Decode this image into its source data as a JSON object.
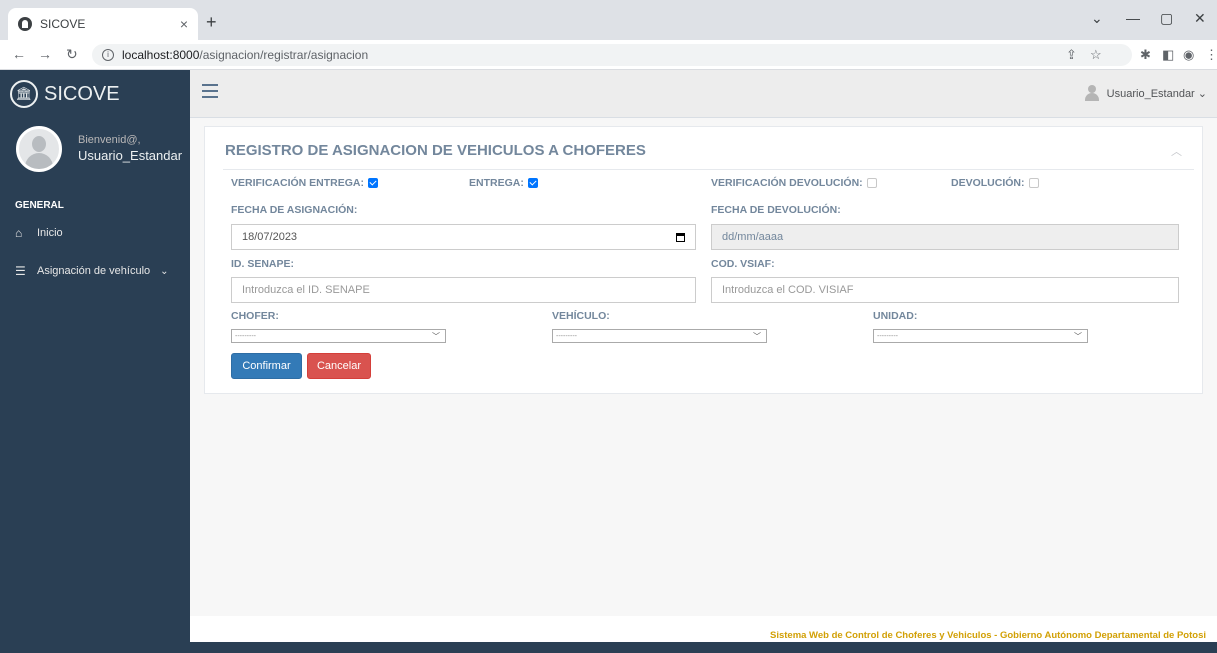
{
  "browser": {
    "tab_title": "SICOVE",
    "tab_close": "×",
    "new_tab": "+",
    "url_host": "localhost:8000",
    "url_path": "/asignacion/registrar/asignacion"
  },
  "sidebar": {
    "brand": "SICOVE",
    "welcome": "Bienvenid@,",
    "username": "Usuario_Estandar",
    "section": "GENERAL",
    "items": [
      {
        "label": "Inicio",
        "icon": "home-icon"
      },
      {
        "label": "Asignación de vehículo",
        "icon": "list-icon"
      }
    ]
  },
  "topnav": {
    "user_label": "Usuario_Estandar ⌄"
  },
  "form": {
    "title": "REGISTRO DE ASIGNACION DE VEHICULOS A CHOFERES",
    "verificacion_entrega": {
      "label": "VERIFICACIÓN ENTREGA:",
      "checked": true
    },
    "entrega": {
      "label": "ENTREGA:",
      "checked": true
    },
    "verificacion_devolucion": {
      "label": "VERIFICACIÓN DEVOLUCIÓN:",
      "checked": false
    },
    "devolucion": {
      "label": "DEVOLUCIÓN:",
      "checked": false
    },
    "fecha_asignacion": {
      "label": "FECHA DE ASIGNACIÓN:",
      "value": "18/07/2023"
    },
    "fecha_devolucion": {
      "label": "FECHA DE DEVOLUCIÓN:",
      "value": "dd/mm/aaaa"
    },
    "id_senape": {
      "label": "ID. SENAPE:",
      "placeholder": "Introduzca el ID. SENAPE"
    },
    "cod_vsiaf": {
      "label": "COD. VSIAF:",
      "placeholder": "Introduzca el COD. VISIAF"
    },
    "chofer": {
      "label": "CHOFER:",
      "value": "---------"
    },
    "vehiculo": {
      "label": "VEHÍCULO:",
      "value": "---------"
    },
    "unidad": {
      "label": "UNIDAD:",
      "value": "---------"
    },
    "confirm_label": "Confirmar",
    "cancel_label": "Cancelar"
  },
  "footer": {
    "text": "Sistema Web de Control de Choferes y Vehiculos - Gobierno Autónomo Departamental de Potosi"
  },
  "colors": {
    "sidebar_bg": "#2a3f54",
    "primary": "#337ab7",
    "danger": "#d9534f",
    "footer_text": "#d2a005"
  }
}
